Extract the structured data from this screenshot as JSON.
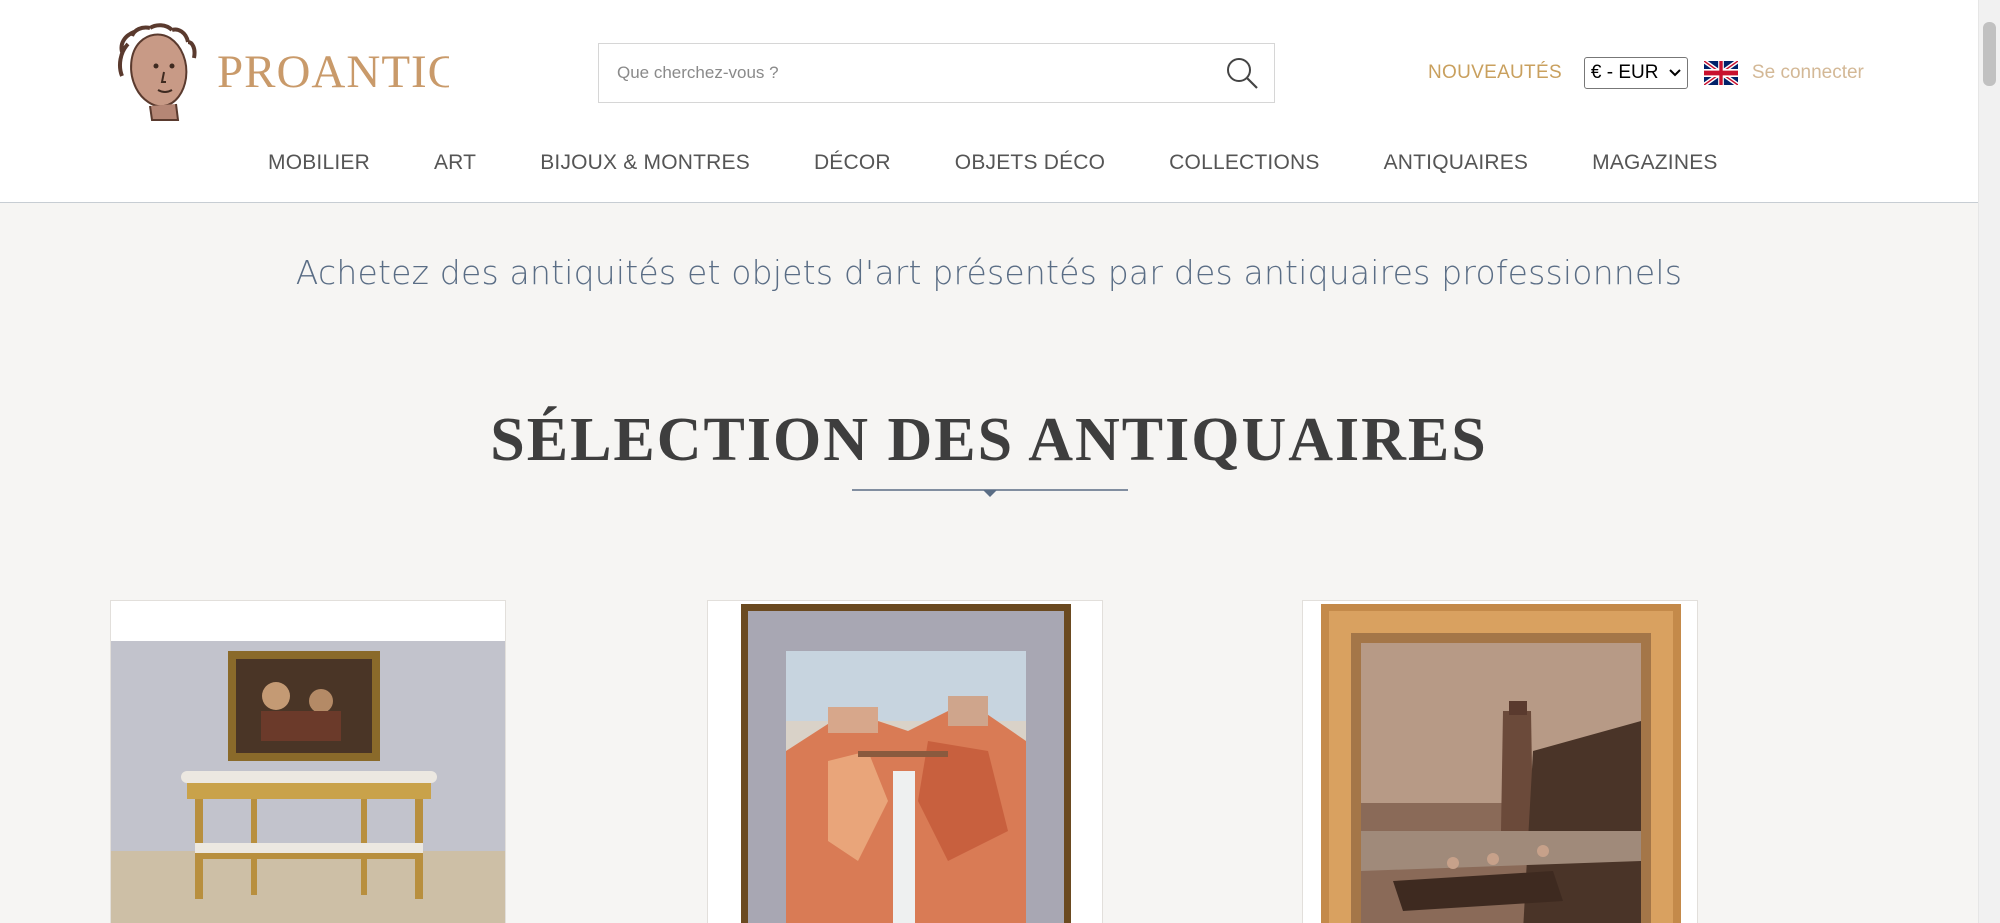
{
  "header": {
    "logo_text": "PROANTIC",
    "search": {
      "placeholder": "Que cherchez-vous ?"
    },
    "nouveautes": "NOUVEAUTÉS",
    "currency": "€ - EUR",
    "language_flag": "uk-flag-icon",
    "login": "Se connecter"
  },
  "nav": {
    "items": [
      "MOBILIER",
      "ART",
      "BIJOUX & MONTRES",
      "DÉCOR",
      "OBJETS DÉCO",
      "COLLECTIONS",
      "ANTIQUAIRES",
      "MAGAZINES"
    ]
  },
  "main": {
    "tagline": "Achetez des antiquités et objets d'art présentés par des antiquaires professionnels",
    "section_title": "SÉLECTION DES ANTIQUAIRES"
  },
  "colors": {
    "brand_gold": "#c99a6a",
    "title_blue": "#5a6d85",
    "background": "#f6f5f3"
  }
}
